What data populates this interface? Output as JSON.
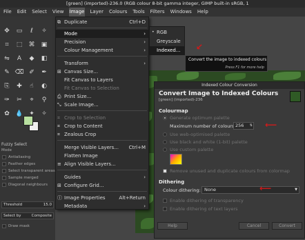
{
  "window": {
    "title": "[green] (imported)-236.0 (RGB colour 8-bit gamma integer, GIMP built-in sRGB, 1"
  },
  "menubar": [
    "File",
    "Edit",
    "Select",
    "View",
    "Image",
    "Layer",
    "Colours",
    "Tools",
    "Filters",
    "Windows",
    "Help"
  ],
  "image_menu": {
    "duplicate": {
      "label": "Duplicate",
      "shortcut": "Ctrl+D"
    },
    "mode": "Mode",
    "precision": "Precision",
    "colour_management": "Colour Management",
    "transform": "Transform",
    "canvas_size": "Canvas Size...",
    "fit_canvas_layers": "Fit Canvas to Layers",
    "fit_canvas_selection": "Fit Canvas to Selection",
    "print_size": "Print Size...",
    "scale_image": "Scale Image...",
    "crop_selection": "Crop to Selection",
    "crop_content": "Crop to Content",
    "zealous_crop": "Zealous Crop",
    "merge_visible": {
      "label": "Merge Visible Layers...",
      "shortcut": "Ctrl+M"
    },
    "flatten": "Flatten Image",
    "align_visible": "Align Visible Layers...",
    "guides": "Guides",
    "configure_grid": "Configure Grid...",
    "image_properties": {
      "label": "Image Properties",
      "shortcut": "Alt+Return"
    },
    "metadata": "Metadata"
  },
  "mode_submenu": [
    "RGB",
    "Greyscale",
    "Indexed..."
  ],
  "tooltip": {
    "text": "Convert the image to indexed colours",
    "hint": "Press F1 for more help"
  },
  "tool_options": {
    "title": "Fuzzy Select",
    "mode_label": "Mode",
    "antialiasing": "Antialiasing",
    "feather": "Feather edges",
    "select_transparent": "Select transparent areas",
    "sample_merged": "Sample merged",
    "diagonal": "Diagonal neighbours",
    "threshold_label": "Threshold",
    "threshold_value": "15.0",
    "select_by_label": "Select by",
    "select_by_value": "Composite",
    "draw_mask": "Draw mask"
  },
  "dialog": {
    "window_title": "Indexed Colour Conversion",
    "heading": "Convert Image to Indexed Colours",
    "subheading": "[green] (imported)-236",
    "colourmap_label": "Colourmap",
    "generate_optimum": "Generate optimum palette",
    "max_colours_label": "Maximum number of colours:",
    "max_colours_value": "256",
    "web_optimised": "Use web-optimised palette",
    "black_white": "Use black and white (1-bit) palette",
    "custom": "Use custom palette",
    "remove_unused": "Remove unused and duplicate colours from colormap",
    "dithering_label": "Dithering",
    "colour_dithering_label": "Colour dithering:",
    "colour_dithering_value": "None",
    "dither_transparency": "Enable dithering of transparency",
    "dither_text": "Enable dithering of text layers",
    "help": "Help",
    "cancel": "Cancel",
    "convert": "Convert"
  },
  "colors": {
    "annotation_arrow": "#d21a1a",
    "foreground": "#b8e0a0"
  }
}
